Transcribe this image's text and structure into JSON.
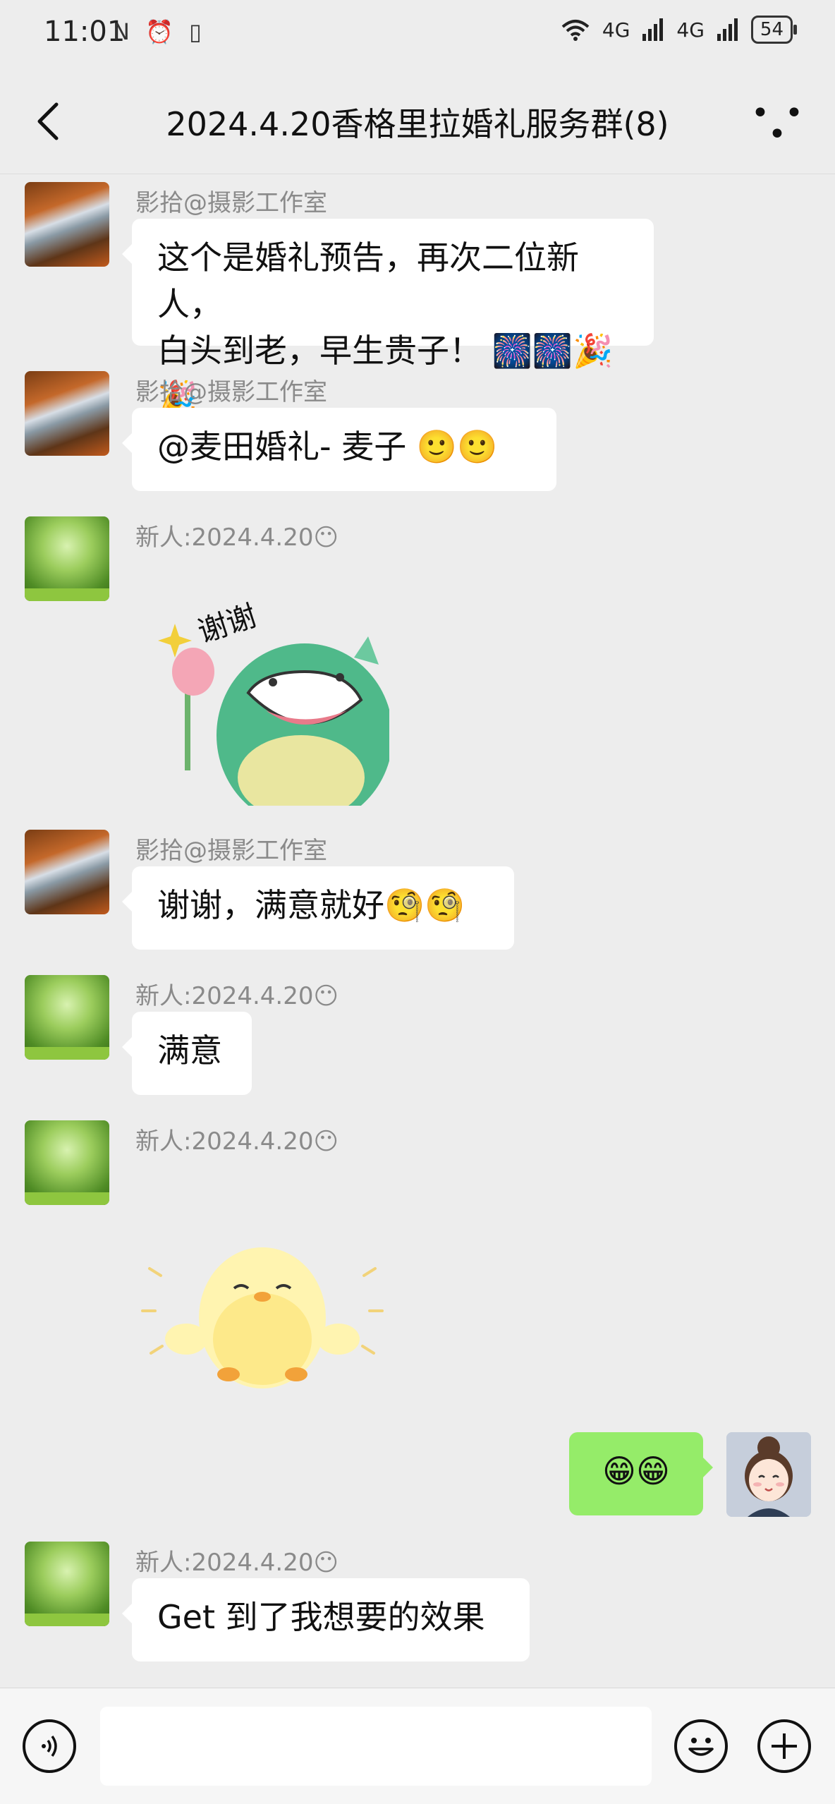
{
  "status_bar": {
    "time": "11:01",
    "left_icons": "N ⏰ ▯",
    "network_1": "4G",
    "network_2": "4G",
    "battery": "54"
  },
  "header": {
    "title": "2024.4.20香格里拉婚礼服务群(8)"
  },
  "messages": [
    {
      "sender": "影拾@摄影工作室",
      "text_line1": "这个是婚礼预告，再次二位新人，",
      "text_line2": "白头到老，早生贵子！ 🎆🎆🎉🎉"
    },
    {
      "sender": "影拾@摄影工作室",
      "text": "@麦田婚礼- 麦子 🙂🙂"
    },
    {
      "sender": "新人:2024.4.20😶",
      "sticker_text": "谢谢"
    },
    {
      "sender": "影拾@摄影工作室",
      "text": "谢谢，满意就好🧐🧐"
    },
    {
      "sender": "新人:2024.4.20😶",
      "text": "满意"
    },
    {
      "sender": "新人:2024.4.20😶"
    },
    {
      "text": "😁😁"
    },
    {
      "sender": "新人:2024.4.20😶",
      "text": "Get 到了我想要的效果"
    }
  ],
  "colors": {
    "background": "#ededed",
    "my_bubble": "#95ec69",
    "other_bubble": "#ffffff"
  }
}
